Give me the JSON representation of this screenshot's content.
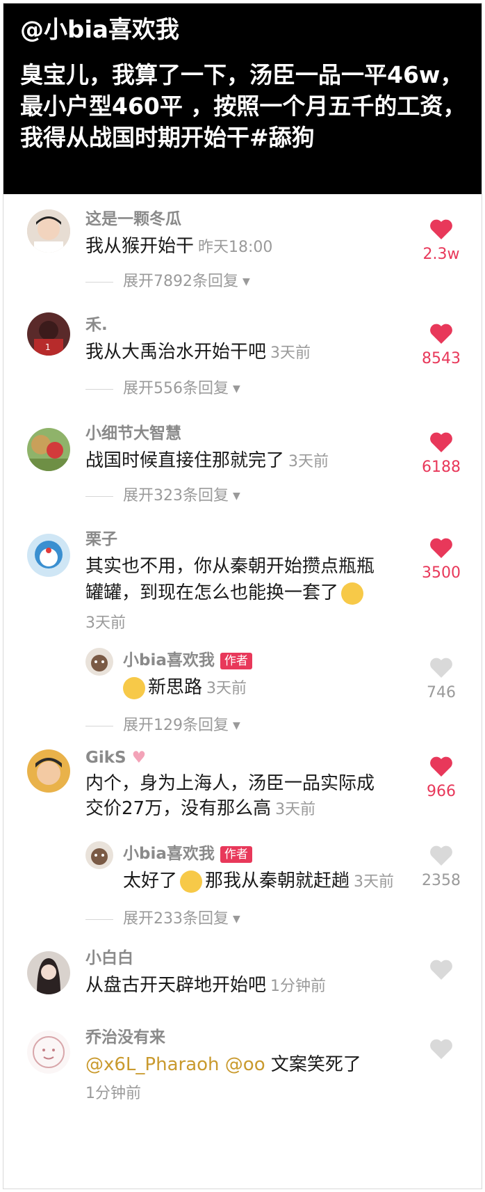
{
  "header": {
    "author": "@小bia喜欢我",
    "caption": "臭宝儿，我算了一下，汤臣一品一平46w，最小户型460平 ，按照一个月五千的工资，我得从战国时期开始干#舔狗"
  },
  "comments": [
    {
      "name": "这是一颗冬瓜",
      "text": "我从猴开始干",
      "time": "昨天18:00",
      "likes": "2.3w",
      "liked": true,
      "expand": "展开7892条回复"
    },
    {
      "name": "禾.",
      "text": "我从大禹治水开始干吧",
      "time": "3天前",
      "likes": "8543",
      "liked": true,
      "expand": "展开556条回复"
    },
    {
      "name": "小细节大智慧",
      "text": "战国时候直接住那就完了",
      "time": "3天前",
      "likes": "6188",
      "liked": true,
      "expand": "展开323条回复"
    },
    {
      "name": "栗子",
      "text_line1": "其实也不用，你从秦朝开始攒点瓶瓶",
      "text_line2": "罐罐，到现在怎么也能换一套了",
      "time": "3天前",
      "likes": "3500",
      "liked": true,
      "reply": {
        "name": "小bia喜欢我",
        "badge": "作者",
        "text": "新思路",
        "time": "3天前",
        "likes": "746",
        "liked": false
      },
      "expand": "展开129条回复"
    },
    {
      "name": "GikS",
      "text_line1": "内个，身为上海人，汤臣一品实际成",
      "text_line2": "交价27万，没有那么高",
      "time": "3天前",
      "likes": "966",
      "liked": true,
      "reply": {
        "name": "小bia喜欢我",
        "badge": "作者",
        "text_before": "太好了",
        "text_after": "那我从秦朝就赶趟",
        "time": "3天前",
        "likes": "2358",
        "liked": false
      },
      "expand": "展开233条回复"
    },
    {
      "name": "小白白",
      "text": "从盘古开天辟地开始吧",
      "time": "1分钟前",
      "liked": false
    },
    {
      "name": "乔治没有来",
      "mention1": "@x6L_Pharaoh",
      "mention2": "@oo",
      "text": "文案笑死了",
      "time": "1分钟前",
      "liked": false
    }
  ],
  "colors": {
    "accent": "#e8385a",
    "gray_heart": "#d9d9d9",
    "mention": "#c99a2e"
  }
}
